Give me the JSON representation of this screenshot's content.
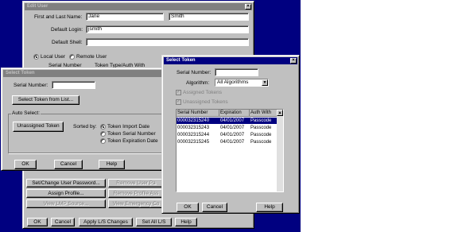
{
  "edit_user": {
    "title": "Edit User",
    "first_last_label": "First and Last Name:",
    "first_name": "Jane",
    "last_name": "Smith",
    "login_label": "Default Login:",
    "login_value": "jsmith",
    "shell_label": "Default Shell:",
    "shell_value": "",
    "local_user": "Local User",
    "remote_user": "Remote User",
    "col_serial": "Serial Number",
    "col_token_type": "Token Type/Auth With",
    "set_change_password": "Set/Change User Password...",
    "assign_profile": "Assign Profile...",
    "view_lmp_source": "View LMP Source...",
    "remove_user_pw": "Remove User Pa",
    "remove_profile": "Remove Profile Ass",
    "view_emergency": "View Emergency Co",
    "ok": "OK",
    "cancel": "Cancel",
    "apply": "Apply L/S Changes",
    "set_all": "Set All L/S",
    "help": "Help"
  },
  "select_token_left": {
    "title": "Select Token",
    "serial_label": "Serial Number:",
    "serial_value": "",
    "select_from_list": "Select Token from List...",
    "auto_select": "Auto Select:",
    "unassigned_token": "Unassigned Token",
    "sorted_by": "Sorted by:",
    "sort_import": "Token Import Date",
    "sort_serial": "Token Serial Number",
    "sort_expiration": "Token Expiration Date",
    "ok": "OK",
    "cancel": "Cancel",
    "help": "Help"
  },
  "select_token_right": {
    "title": "Select Token",
    "serial_label": "Serial Number:",
    "serial_value": "",
    "algorithm_label": "Algorithm:",
    "algorithm_value": "All Algorithms",
    "assigned_tokens": "Assigned Tokens",
    "unassigned_tokens": "Unassigned Tokens",
    "columns": [
      "Serial Number",
      "Expiration",
      "Auth With"
    ],
    "rows": [
      [
        "000032315240",
        "04/01/2007",
        "Passcode"
      ],
      [
        "000032315243",
        "04/01/2007",
        "Passcode"
      ],
      [
        "000032315244",
        "04/01/2007",
        "Passcode"
      ],
      [
        "000032315245",
        "04/01/2007",
        "Passcode"
      ]
    ],
    "ok": "OK",
    "cancel": "Cancel",
    "help": "Help"
  },
  "icons": {
    "close": "close-icon",
    "dropdown": "chevron-down-icon",
    "scroll_up": "scroll-up-icon"
  },
  "colors": {
    "desktop": "#000080",
    "active_title": "#000080",
    "inactive_title": "#808080",
    "selection": "#000080",
    "face": "#c0c0c0"
  }
}
